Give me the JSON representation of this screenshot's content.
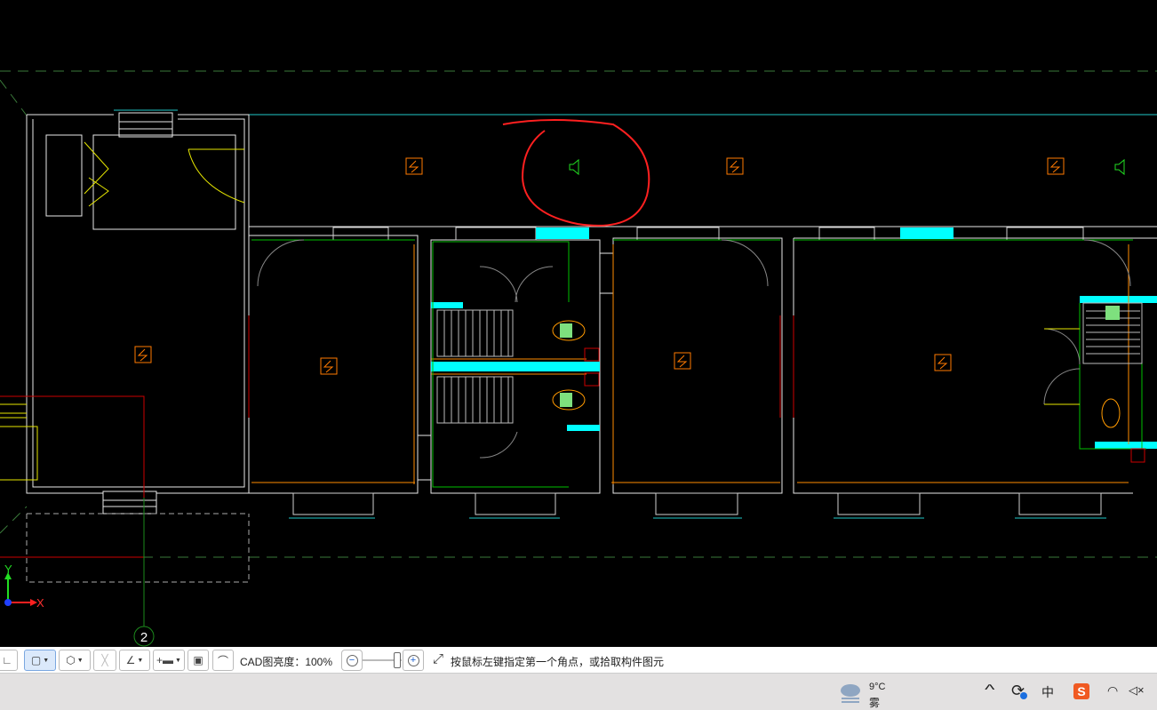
{
  "canvas": {
    "axis_label": "2",
    "ucs_y": "Y",
    "ucs_x": "X"
  },
  "toolbar": {
    "brightness_label": "CAD图亮度：100%",
    "brightness_percent": 100,
    "hint": "按鼠标左键指定第一个角点，或拾取构件图元",
    "zoom_out": "−",
    "zoom_in": "+"
  },
  "taskbar": {
    "weather_temp": "9°C",
    "weather_desc": "雾",
    "ime": "中",
    "sogou": "S",
    "chevron": "^",
    "volume": "🔇"
  },
  "colors": {
    "wall": "#ffffff",
    "cyan": "#00ffff",
    "green": "#00d000",
    "orange": "#ff8000",
    "red": "#ff0000",
    "yellow": "#e6e600",
    "selected": "#dbe9fb"
  }
}
